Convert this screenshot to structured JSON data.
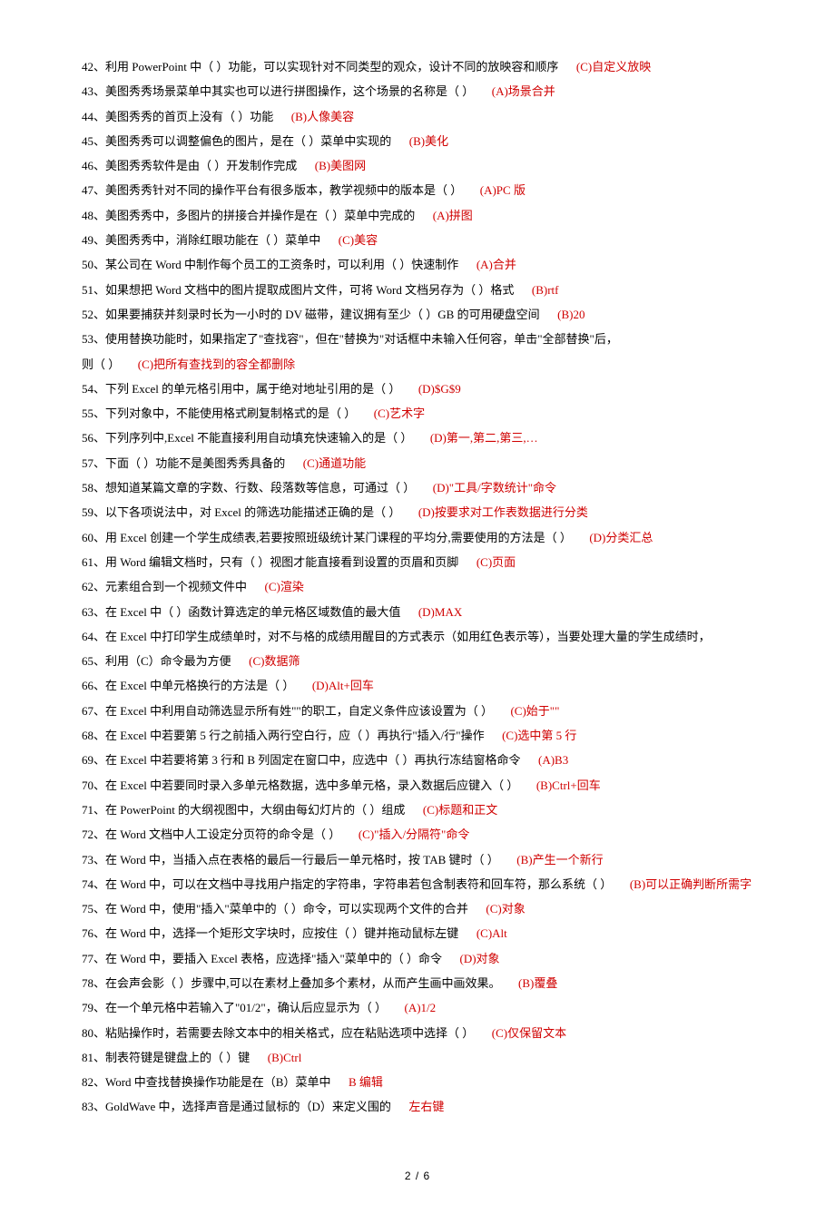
{
  "lines": [
    {
      "num": "42",
      "q": "利用 PowerPoint 中（ ）功能，可以实现针对不同类型的观众，设计不同的放映容和顺序",
      "a": "(C)自定义放映"
    },
    {
      "num": "43",
      "q": "美图秀秀场景菜单中其实也可以进行拼图操作，这个场景的名称是（ ）",
      "a": "(A)场景合并"
    },
    {
      "num": "44",
      "q": "美图秀秀的首页上没有（ ）功能",
      "a": "(B)人像美容"
    },
    {
      "num": "45",
      "q": "美图秀秀可以调整偏色的图片，是在（ ）菜单中实现的",
      "a": "(B)美化"
    },
    {
      "num": "46",
      "q": "美图秀秀软件是由（ ）开发制作完成",
      "a": "(B)美图网"
    },
    {
      "num": "47",
      "q": "美图秀秀针对不同的操作平台有很多版本，教学视频中的版本是（ ）",
      "a": "(A)PC 版"
    },
    {
      "num": "48",
      "q": "美图秀秀中，多图片的拼接合并操作是在（ ）菜单中完成的",
      "a": "(A)拼图"
    },
    {
      "num": "49",
      "q": "美图秀秀中，消除红眼功能在（ ）菜单中",
      "a": "(C)美容"
    },
    {
      "num": "50",
      "q": "某公司在 Word 中制作每个员工的工资条时，可以利用（ ）快速制作",
      "a": "(A)合并"
    },
    {
      "num": "51",
      "q": "如果想把 Word 文档中的图片提取成图片文件，可将 Word 文档另存为（ ）格式",
      "a": "(B)rtf"
    },
    {
      "num": "52",
      "q": "如果要捕获并刻录时长为一小时的 DV 磁带，建议拥有至少（ ）GB 的可用硬盘空间",
      "a": "(B)20"
    },
    {
      "num": "53",
      "q": "使用替换功能时，如果指定了\"查找容\"，但在\"替换为\"对话框中未输入任何容，单击\"全部替换\"后，",
      "a": ""
    },
    {
      "num": "",
      "q": "则（ ）",
      "a": "(C)把所有查找到的容全都删除"
    },
    {
      "num": "54",
      "q": "下列 Excel 的单元格引用中，属于绝对地址引用的是（ ）",
      "a": "(D)$G$9"
    },
    {
      "num": "55",
      "q": "下列对象中，不能使用格式刷复制格式的是（ ）",
      "a": "(C)艺术字"
    },
    {
      "num": "56",
      "q": "下列序列中,Excel 不能直接利用自动填充快速输入的是（ ）",
      "a": "(D)第一,第二,第三,…"
    },
    {
      "num": "57",
      "q": "下面（ ）功能不是美图秀秀具备的",
      "a": "(C)通道功能"
    },
    {
      "num": "58",
      "q": "想知道某篇文章的字数、行数、段落数等信息，可通过（ ）",
      "a": "(D)\"工具/字数统计\"命令"
    },
    {
      "num": "59",
      "q": "以下各项说法中，对 Excel 的筛选功能描述正确的是（ ）",
      "a": "(D)按要求对工作表数据进行分类"
    },
    {
      "num": "60",
      "q": "用 Excel 创建一个学生成绩表,若要按照班级统计某门课程的平均分,需要使用的方法是（ ）",
      "a": "(D)分类汇总"
    },
    {
      "num": "61",
      "q": "用 Word 编辑文档时，只有（ ）视图才能直接看到设置的页眉和页脚",
      "a": "(C)页面"
    },
    {
      "num": "62",
      "q": "元素组合到一个视频文件中",
      "a": "(C)渲染"
    },
    {
      "num": "63",
      "q": "在 Excel 中（ ）函数计算选定的单元格区域数值的最大值",
      "a": "(D)MAX"
    },
    {
      "num": "64",
      "q": "在 Excel 中打印学生成绩单时，对不与格的成绩用醒目的方式表示（如用红色表示等），当要处理大量的学生成绩时，",
      "a": ""
    },
    {
      "num": "65",
      "q": "利用（C）命令最为方便",
      "a": "(C)数据筛"
    },
    {
      "num": "66",
      "q": "在 Excel 中单元格换行的方法是（ ）",
      "a": "(D)Alt+回车"
    },
    {
      "num": "67",
      "q": "在 Excel 中利用自动筛选显示所有姓\"\"的职工，自定义条件应该设置为（ ）",
      "a": "(C)始于\"\""
    },
    {
      "num": "68",
      "q": "在 Excel 中若要第 5 行之前插入两行空白行，应（ ）再执行\"插入/行\"操作",
      "a": "(C)选中第 5 行"
    },
    {
      "num": "69",
      "q": "在 Excel 中若要将第 3 行和 B 列固定在窗口中，应选中（ ）再执行冻结窗格命令",
      "a": "(A)B3"
    },
    {
      "num": "70",
      "q": "在 Excel 中若要同时录入多单元格数据，选中多单元格，录入数据后应键入（ ）",
      "a": "(B)Ctrl+回车"
    },
    {
      "num": "71",
      "q": "在 PowerPoint 的大纲视图中，大纲由每幻灯片的（ ）组成",
      "a": "(C)标题和正文"
    },
    {
      "num": "72",
      "q": "在 Word 文档中人工设定分页符的命令是（ ）",
      "a": "(C)\"插入/分隔符\"命令"
    },
    {
      "num": "73",
      "q": "在 Word 中，当插入点在表格的最后一行最后一单元格时，按 TAB 键时（ ）",
      "a": "(B)产生一个新行"
    },
    {
      "num": "74",
      "q": "在 Word 中，可以在文档中寻找用户指定的字符串，字符串若包含制表符和回车符，那么系统（ ）",
      "a": "(B)可以正确判断所需字"
    },
    {
      "num": "75",
      "q": "在 Word 中，使用\"插入\"菜单中的（ ）命令，可以实现两个文件的合并",
      "a": "(C)对象"
    },
    {
      "num": "76",
      "q": "在 Word 中，选择一个矩形文字块时，应按住（ ）键并拖动鼠标左键",
      "a": "(C)Alt"
    },
    {
      "num": "77",
      "q": "在 Word 中，要插入 Excel 表格，应选择\"插入\"菜单中的（ ）命令",
      "a": "(D)对象"
    },
    {
      "num": "78",
      "q": "在会声会影（ ）步骤中,可以在素材上叠加多个素材，从而产生画中画效果。",
      "a": "(B)覆叠"
    },
    {
      "num": "79",
      "q": "在一个单元格中若输入了\"01/2\"，确认后应显示为（ ）",
      "a": "(A)1/2"
    },
    {
      "num": "80",
      "q": "粘贴操作时，若需要去除文本中的相关格式，应在粘贴选项中选择（ ）",
      "a": "(C)仅保留文本"
    },
    {
      "num": "81",
      "q": "制表符键是键盘上的（ ）键",
      "a": "(B)Ctrl"
    },
    {
      "num": "82",
      "q": "Word 中查找替换操作功能是在（B）菜单中",
      "a": "B 编辑"
    },
    {
      "num": "83",
      "q": "GoldWave 中，选择声音是通过鼠标的（D）来定义围的",
      "a": "左右键"
    }
  ],
  "footer": "2 / 6"
}
